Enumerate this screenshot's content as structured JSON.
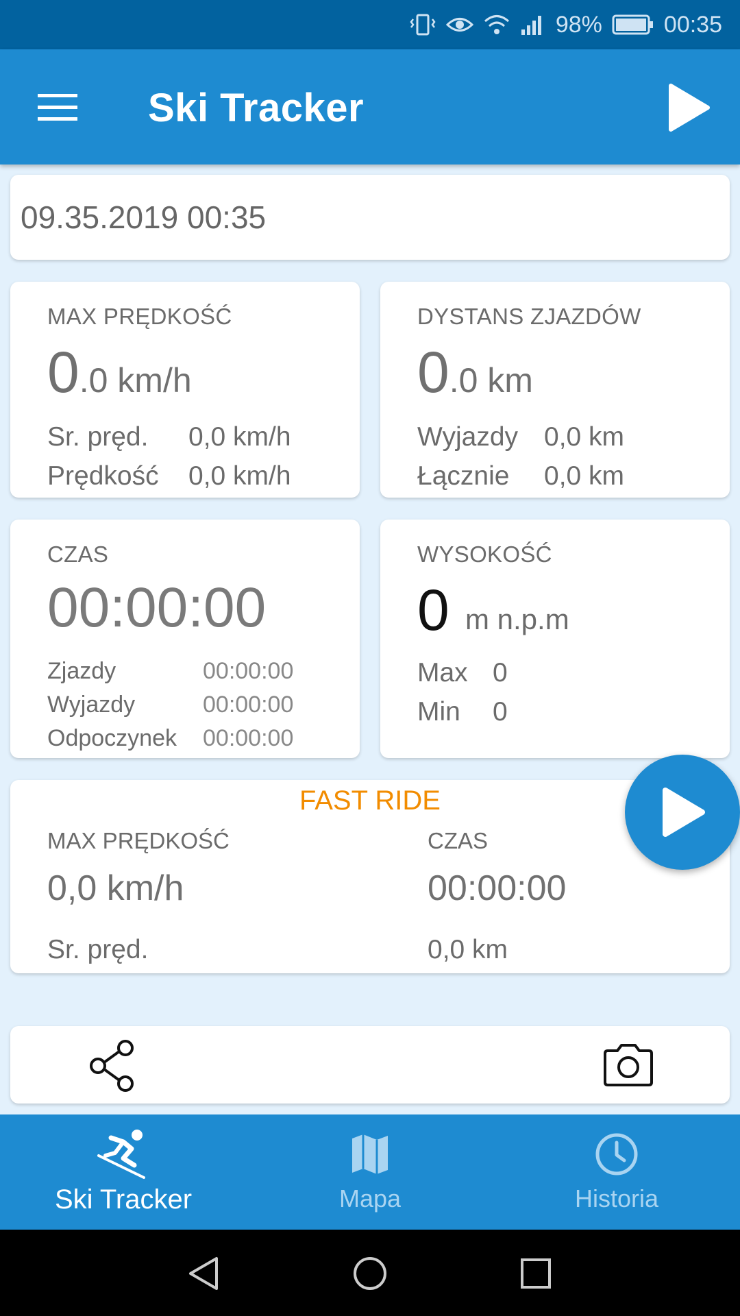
{
  "status_bar": {
    "battery": "98%",
    "time": "00:35",
    "icons": [
      "vibrate-icon",
      "eye-icon",
      "wifi-icon",
      "signal-icon",
      "battery-icon"
    ]
  },
  "app_bar": {
    "title": "Ski Tracker",
    "menu_icon": "menu-icon",
    "play_icon": "play-icon"
  },
  "date": "09.35.2019 00:35",
  "cards": {
    "max_speed": {
      "label": "MAX PRĘDKOŚĆ",
      "big_int": "0",
      "big_rest": ".0 km/h",
      "rows": [
        {
          "label": "Sr. pręd.",
          "value": "0,0 km/h"
        },
        {
          "label": "Prędkość",
          "value": "0,0 km/h"
        }
      ]
    },
    "distance": {
      "label": "DYSTANS ZJAZDÓW",
      "big_int": "0",
      "big_rest": ".0 km",
      "rows": [
        {
          "label": "Wyjazdy",
          "value": "0,0 km"
        },
        {
          "label": "Łącznie",
          "value": "0,0 km"
        }
      ]
    },
    "time": {
      "label": "CZAS",
      "big": "00:00:00",
      "rows": [
        {
          "label": "Zjazdy",
          "value": "00:00:00"
        },
        {
          "label": "Wyjazdy",
          "value": "00:00:00"
        },
        {
          "label": "Odpoczynek",
          "value": "00:00:00"
        }
      ]
    },
    "altitude": {
      "label": "WYSOKOŚĆ",
      "big": "0",
      "unit": "m n.p.m",
      "rows": [
        {
          "label": "Max",
          "value": "0"
        },
        {
          "label": "Min",
          "value": "0"
        }
      ]
    }
  },
  "fast_ride": {
    "title": "FAST RIDE",
    "left": {
      "label": "MAX PRĘDKOŚĆ",
      "value": "0,0 km/h",
      "sub": "Sr. pręd."
    },
    "right": {
      "label": "CZAS",
      "value": "00:00:00",
      "sub": "0,0 km"
    }
  },
  "actions": {
    "share_icon": "share-icon",
    "camera_icon": "camera-icon"
  },
  "bottom_nav": [
    {
      "label": "Ski Tracker",
      "icon": "skier-icon",
      "active": true
    },
    {
      "label": "Mapa",
      "icon": "map-icon",
      "active": false
    },
    {
      "label": "Historia",
      "icon": "clock-icon",
      "active": false
    }
  ],
  "colors": {
    "primary": "#1e8bd1",
    "status_bar": "#02629f",
    "background": "#e3f1fc",
    "accent_orange": "#f28c00"
  }
}
